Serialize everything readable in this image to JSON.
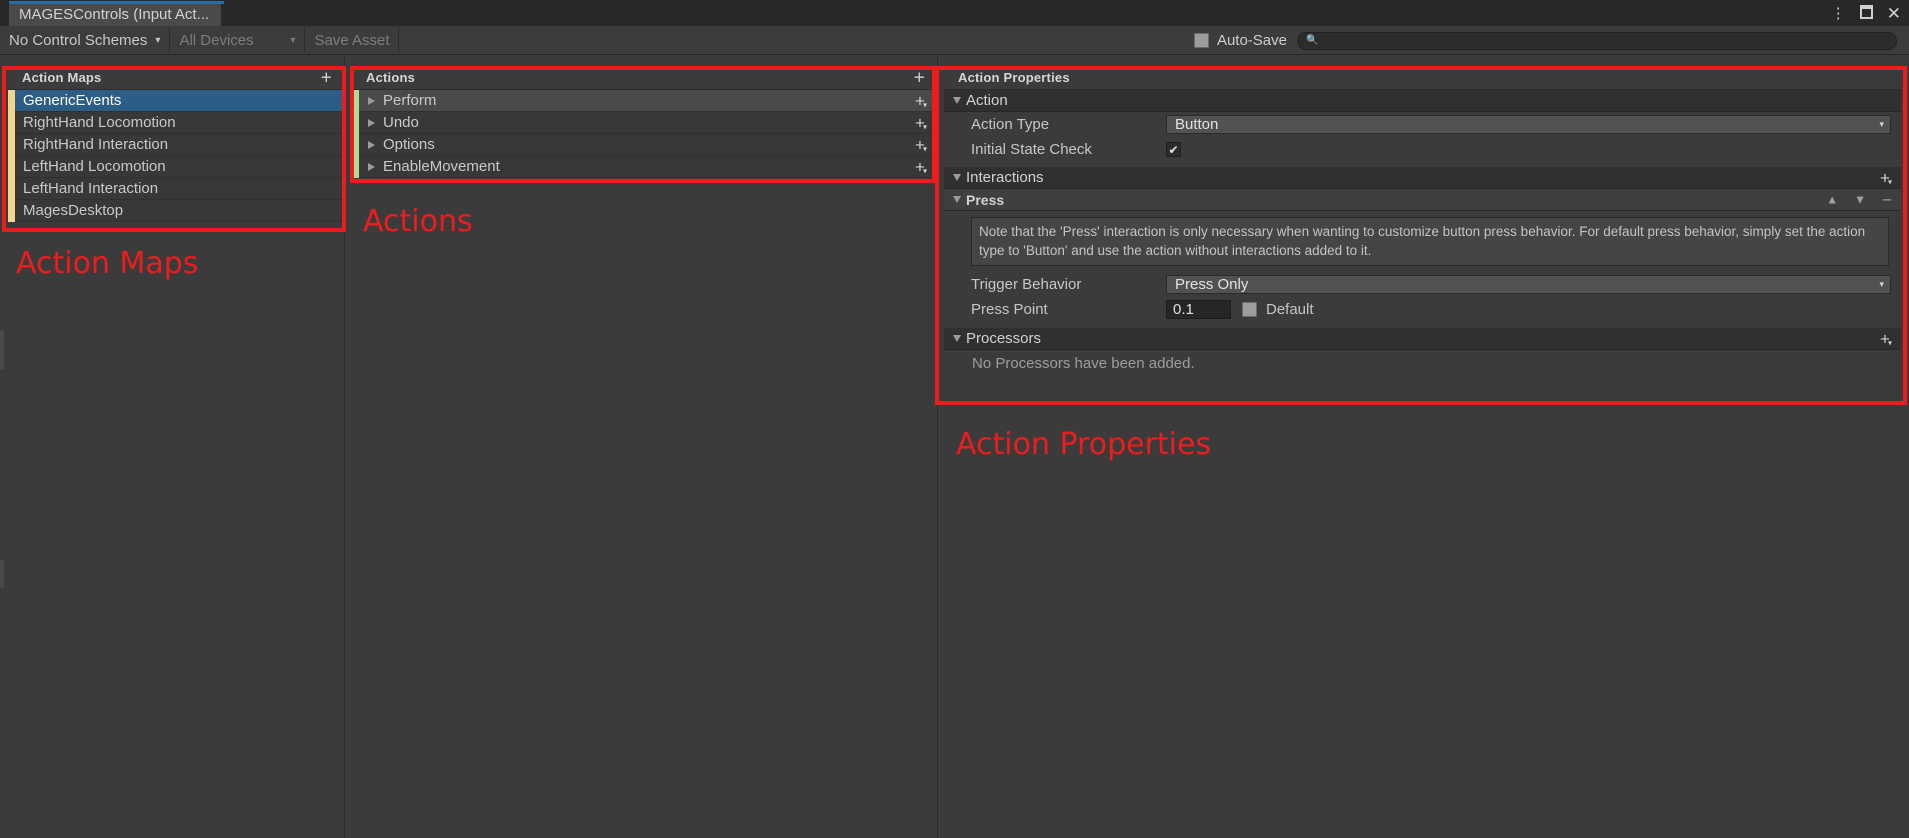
{
  "window": {
    "tab_title": "MAGESControls (Input Act...",
    "kebab_icon": "more-options-icon",
    "maximize_icon": "maximize-icon",
    "close_label": "✕"
  },
  "toolbar": {
    "control_schemes_label": "No Control Schemes",
    "control_schemes_caret": "▾",
    "devices_label": "All Devices",
    "devices_caret": "▾",
    "save_asset_label": "Save Asset",
    "autosave_label": "Auto-Save",
    "autosave_checked": false,
    "search_value": "",
    "search_placeholder": "",
    "search_icon": "search-icon"
  },
  "action_maps": {
    "header": "Action Maps",
    "add_label": "+",
    "items": [
      {
        "label": "GenericEvents",
        "selected": true
      },
      {
        "label": "RightHand Locomotion",
        "selected": false
      },
      {
        "label": "RightHand Interaction",
        "selected": false
      },
      {
        "label": "LeftHand Locomotion",
        "selected": false
      },
      {
        "label": "LeftHand Interaction",
        "selected": false
      },
      {
        "label": "MagesDesktop",
        "selected": false
      }
    ],
    "marker_color": "#f0d68c"
  },
  "actions": {
    "header": "Actions",
    "add_label": "+",
    "row_add_label": "+",
    "items": [
      {
        "label": "Perform",
        "expanded": false,
        "highlighted": true
      },
      {
        "label": "Undo",
        "expanded": false,
        "highlighted": false
      },
      {
        "label": "Options",
        "expanded": false,
        "highlighted": false
      },
      {
        "label": "EnableMovement",
        "expanded": false,
        "highlighted": false
      }
    ],
    "marker_color": "#aedb9a"
  },
  "properties": {
    "header": "Action Properties",
    "action_section": {
      "title": "Action",
      "action_type_label": "Action Type",
      "action_type_value": "Button",
      "initial_state_label": "Initial State Check",
      "initial_state_checked": true,
      "check_glyph": "✔"
    },
    "interactions_section": {
      "title": "Interactions",
      "add_label": "+",
      "press": {
        "title": "Press",
        "move_up_icon": "chevron-up-icon",
        "move_down_icon": "chevron-down-icon",
        "remove_icon": "minus-icon",
        "note": "Note that the 'Press' interaction is only necessary when wanting to customize button press behavior. For default press behavior, simply set the action type to 'Button' and use the action without interactions added to it.",
        "trigger_behavior_label": "Trigger Behavior",
        "trigger_behavior_value": "Press Only",
        "press_point_label": "Press Point",
        "press_point_value": "0.1",
        "default_label": "Default",
        "default_checked": false
      }
    },
    "processors_section": {
      "title": "Processors",
      "add_label": "+",
      "empty_message": "No Processors have been added."
    }
  },
  "annotations": {
    "action_maps_label": "Action Maps",
    "actions_label": "Actions",
    "action_properties_label": "Action Properties",
    "color": "#ee1c1c"
  }
}
